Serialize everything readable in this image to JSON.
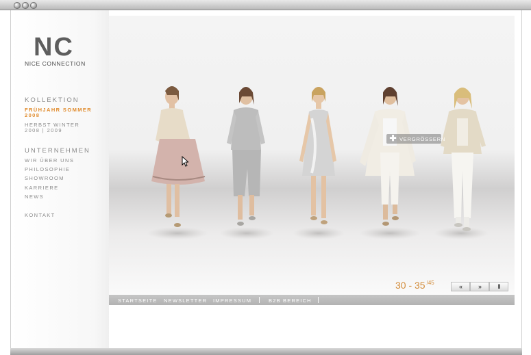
{
  "logo": {
    "mark": "NC",
    "text": "NICE CONNECTION"
  },
  "sidebar": {
    "kollektion_title": "KOLLEKTION",
    "kollektion_items": [
      {
        "line1": "FRÜHJAHR SOMMER",
        "line2": "2008",
        "active": true
      },
      {
        "line1": "HERBST WINTER",
        "line2": "2008 | 2009",
        "active": false
      }
    ],
    "unternehmen_title": "UNTERNEHMEN",
    "unternehmen_items": [
      "WIR ÜBER UNS",
      "PHILOSOPHIE",
      "SHOWROOM",
      "KARRIERE",
      "NEWS"
    ],
    "kontakt": "KONTAKT"
  },
  "gallery": {
    "enlarge_label": "VERGRÖSSERN",
    "counter_range": "30 - 35",
    "counter_total": "/45",
    "controls": {
      "prev": "«",
      "next": "»",
      "pause": "II"
    }
  },
  "footer": {
    "links": [
      "STARTSEITE",
      "NEWSLETTER",
      "IMPRESSUM",
      "B2B BEREICH"
    ]
  },
  "colors": {
    "accent": "#e08a2a",
    "text_gray": "#8b8b8b",
    "footer_bar": "#bcbcbc"
  }
}
